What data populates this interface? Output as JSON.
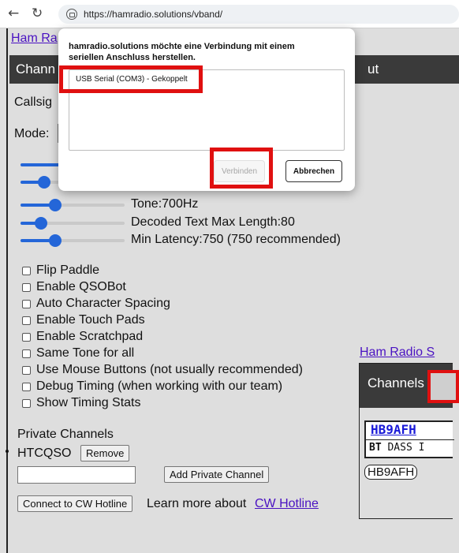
{
  "browser": {
    "url": "https://hamradio.solutions/vband/",
    "back_icon": "arrow-left",
    "reload_icon": "refresh"
  },
  "page": {
    "site_link": "Ham Ra",
    "navbar_left": "Chann",
    "navbar_right": "ut",
    "callsign_label": "Callsig",
    "mode_label": "Mode:",
    "sliders": [
      {
        "label": "Tone:700Hz",
        "fraction": 0.33
      },
      {
        "label": "Decoded Text Max Length:80",
        "fraction": 0.2
      },
      {
        "label": "Min Latency:750 (750 recommended)",
        "fraction": 0.33
      }
    ],
    "checkboxes": [
      {
        "label": "Flip Paddle",
        "checked": false
      },
      {
        "label": "Enable QSOBot",
        "checked": false
      },
      {
        "label": "Auto Character Spacing",
        "checked": false
      },
      {
        "label": "Enable Touch Pads",
        "checked": false
      },
      {
        "label": "Enable Scratchpad",
        "checked": false
      },
      {
        "label": "Same Tone for all",
        "checked": false
      },
      {
        "label": "Use Mouse Buttons (not usually recommended)",
        "checked": false
      },
      {
        "label": "Debug Timing (when working with our team)",
        "checked": false
      },
      {
        "label": "Show Timing Stats",
        "checked": false
      }
    ],
    "private_channels_heading": "Private Channels",
    "private_channel_name": "HTCQSO",
    "remove_button": "Remove",
    "add_private_channel_button": "Add Private Channel",
    "connect_hotline_button": "Connect to CW Hotline",
    "learn_more_text": "Learn more about",
    "cw_hotline_link": "CW Hotline"
  },
  "preview": {
    "link": "Ham Radio S",
    "nav_label": "Channels",
    "callsign": "HB9AFH",
    "decoded_line": "BT DASS I",
    "pill": "HB9AFH"
  },
  "dialog": {
    "title": "hamradio.solutions möchte eine Verbindung mit einem seriellen Anschluss herstellen.",
    "device": "USB Serial (COM3) - Gekoppelt",
    "connect_button": "Verbinden",
    "cancel_button": "Abbrechen"
  },
  "colors": {
    "highlight": "#e01010",
    "slider": "#2466d8",
    "navbar": "#3a3a3a",
    "link": "#4a12c2"
  }
}
